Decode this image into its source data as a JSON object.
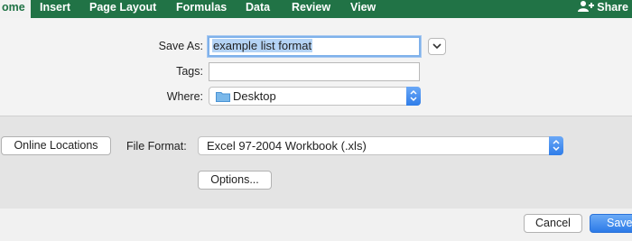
{
  "ribbon": {
    "tabs": [
      "ome",
      "Insert",
      "Page Layout",
      "Formulas",
      "Data",
      "Review",
      "View"
    ],
    "share_label": "Share"
  },
  "dialog": {
    "save_as_label": "Save As:",
    "save_as_value": "example list format",
    "tags_label": "Tags:",
    "tags_value": "",
    "where_label": "Where:",
    "where_value": "Desktop",
    "online_locations_label": "Online Locations",
    "file_format_label": "File Format:",
    "file_format_value": "Excel 97-2004 Workbook (.xls)",
    "options_label": "Options...",
    "cancel_label": "Cancel",
    "save_label": "Save"
  },
  "colors": {
    "ribbon": "#217346",
    "selection": "#b4d3f5",
    "primary": "#2c7ae8"
  }
}
